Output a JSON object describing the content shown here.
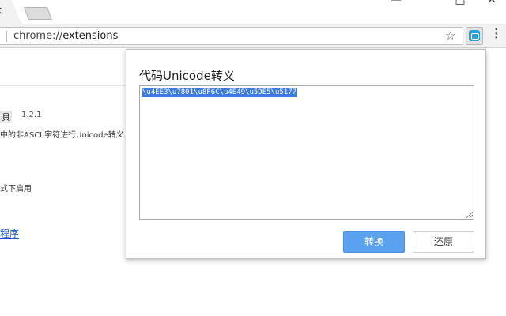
{
  "browser": {
    "tab_close_glyph": "×",
    "window_controls": {
      "minimize": "—",
      "maximize": "□",
      "close": "✕"
    },
    "omnibox": {
      "scheme": "chrome://",
      "host": "extensions"
    },
    "star_glyph": "☆",
    "menu_glyph": "⋮",
    "extension_icon": "database-icon"
  },
  "background_page": {
    "extension_name_fragment": "具",
    "version": "1.2.1",
    "description_fragment": "中的非ASCII字符进行Unicode转义",
    "incognito_fragment": "式下启用",
    "link_fragment": "程序"
  },
  "popup": {
    "title": "代码Unicode转义",
    "textarea_value": "\\u4EE3\\u7801\\u8F6C\\u4E49\\u5DE5\\u5177",
    "convert_label": "转换",
    "restore_label": "还原"
  },
  "colors": {
    "primary_button": "#5aa2f0",
    "selection": "#3b7be0",
    "extension_icon": "#2a9fd8"
  }
}
